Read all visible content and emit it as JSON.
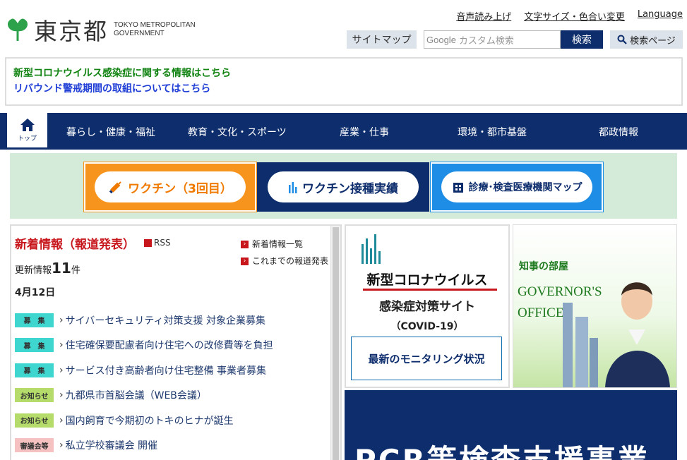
{
  "header": {
    "logo_text": "東京都",
    "logo_sub_line1": "TOKYO METROPOLITAN",
    "logo_sub_line2": "GOVERNMENT",
    "toplinks": [
      "音声読み上げ",
      "文字サイズ・色合い変更",
      "Language"
    ],
    "sitemap": "サイトマップ",
    "search_brand": "Google",
    "search_placeholder": "カスタム検索",
    "search_button": "検索",
    "search_page": "検索ページ"
  },
  "alert": {
    "line1": "新型コロナウイルス感染症に関する情報はこちら",
    "line2": "リバウンド警戒期間の取組についてはこちら"
  },
  "nav": {
    "home": "トップ",
    "items": [
      "暮らし・健康・福祉",
      "教育・文化・スポーツ",
      "産業・仕事",
      "環境・都市基盤",
      "都政情報"
    ]
  },
  "banners": [
    "ワクチン（3回目）",
    "ワクチン接種実績",
    "診療･検査医療機関マップ"
  ],
  "news": {
    "title": "新着情報（報道発表）",
    "rss": "RSS",
    "links": [
      "新着情報一覧",
      "これまでの報道発表"
    ],
    "updated_prefix": "更新情報",
    "updated_count": "11",
    "updated_suffix": "件",
    "date": "4月12日",
    "items": [
      {
        "tag": "募　集",
        "type": "recruit",
        "text": "サイバーセキュリティ対策支援 対象企業募集"
      },
      {
        "tag": "募　集",
        "type": "recruit",
        "text": "住宅確保要配慮者向け住宅への改修費等を負担"
      },
      {
        "tag": "募　集",
        "type": "recruit",
        "text": "サービス付き高齢者向け住宅整備 事業者募集"
      },
      {
        "tag": "お知らせ",
        "type": "notice",
        "text": "九都県市首脳会議（WEB会議）"
      },
      {
        "tag": "お知らせ",
        "type": "notice",
        "text": "国内飼育で今期初のトキのヒナが誕生"
      },
      {
        "tag": "審議会等",
        "type": "council",
        "text": "私立学校審議会 開催"
      }
    ]
  },
  "covid": {
    "title1": "新型コロナウイルス",
    "title2": "感染症対策サイト",
    "title3": "（COVID-19）",
    "monitoring": "最新のモニタリング状況"
  },
  "governor": {
    "jp": "知事の部屋",
    "en1": "GOVERNOR'S",
    "en2": "OFFICE"
  },
  "pcr": {
    "text": "PCR等検査支援事業"
  }
}
